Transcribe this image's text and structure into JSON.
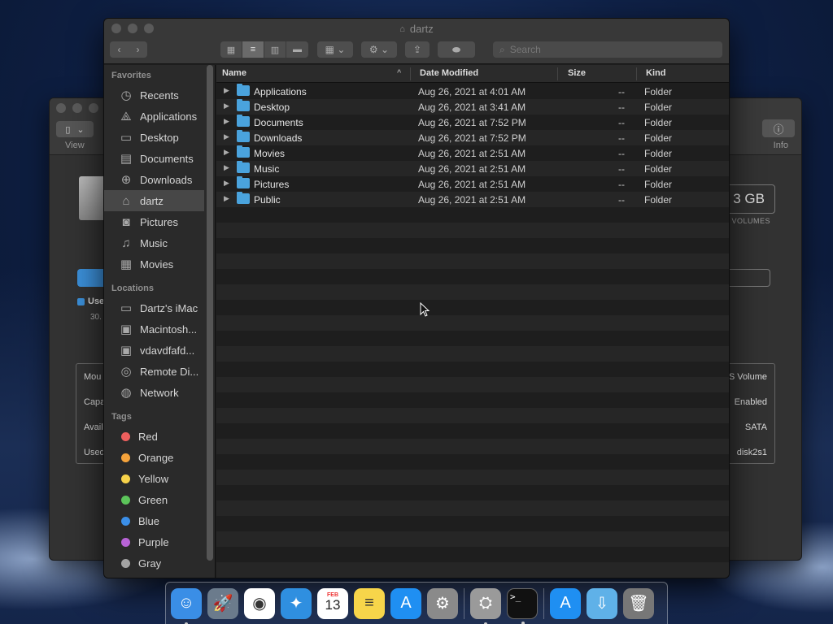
{
  "window": {
    "title": "dartz"
  },
  "toolbar": {
    "search_placeholder": "Search"
  },
  "sidebar": {
    "favorites_header": "Favorites",
    "favorites": [
      {
        "label": "Recents",
        "icon": "clock-icon"
      },
      {
        "label": "Applications",
        "icon": "applications-icon"
      },
      {
        "label": "Desktop",
        "icon": "desktop-icon"
      },
      {
        "label": "Documents",
        "icon": "documents-icon"
      },
      {
        "label": "Downloads",
        "icon": "downloads-icon"
      },
      {
        "label": "dartz",
        "icon": "home-icon",
        "selected": true
      },
      {
        "label": "Pictures",
        "icon": "camera-icon"
      },
      {
        "label": "Music",
        "icon": "music-icon"
      },
      {
        "label": "Movies",
        "icon": "film-icon"
      }
    ],
    "locations_header": "Locations",
    "locations": [
      {
        "label": "Dartz's iMac",
        "icon": "imac-icon"
      },
      {
        "label": "Macintosh...",
        "icon": "disk-icon"
      },
      {
        "label": "vdavdfafd...",
        "icon": "disk-icon"
      },
      {
        "label": "Remote Di...",
        "icon": "optical-disk-icon"
      },
      {
        "label": "Network",
        "icon": "globe-icon"
      }
    ],
    "tags_header": "Tags",
    "tags": [
      {
        "label": "Red",
        "color": "#ec5f5d"
      },
      {
        "label": "Orange",
        "color": "#f5a33b"
      },
      {
        "label": "Yellow",
        "color": "#f7d24a"
      },
      {
        "label": "Green",
        "color": "#5cc45a"
      },
      {
        "label": "Blue",
        "color": "#3b8fe8"
      },
      {
        "label": "Purple",
        "color": "#b863d6"
      },
      {
        "label": "Gray",
        "color": "#a3a3a3"
      }
    ]
  },
  "columns": {
    "name": "Name",
    "date": "Date Modified",
    "size": "Size",
    "kind": "Kind"
  },
  "files": [
    {
      "name": "Applications",
      "date": "Aug 26, 2021 at 4:01 AM",
      "size": "--",
      "kind": "Folder"
    },
    {
      "name": "Desktop",
      "date": "Aug 26, 2021 at 3:41 AM",
      "size": "--",
      "kind": "Folder"
    },
    {
      "name": "Documents",
      "date": "Aug 26, 2021 at 7:52 PM",
      "size": "--",
      "kind": "Folder"
    },
    {
      "name": "Downloads",
      "date": "Aug 26, 2021 at 7:52 PM",
      "size": "--",
      "kind": "Folder"
    },
    {
      "name": "Movies",
      "date": "Aug 26, 2021 at 2:51 AM",
      "size": "--",
      "kind": "Folder"
    },
    {
      "name": "Music",
      "date": "Aug 26, 2021 at 2:51 AM",
      "size": "--",
      "kind": "Folder"
    },
    {
      "name": "Pictures",
      "date": "Aug 26, 2021 at 2:51 AM",
      "size": "--",
      "kind": "Folder"
    },
    {
      "name": "Public",
      "date": "Aug 26, 2021 at 2:51 AM",
      "size": "--",
      "kind": "Folder"
    }
  ],
  "background_window": {
    "view_label": "View",
    "info_label": "Info",
    "capacity": "3 GB",
    "volumes_label": "VOLUMES",
    "used_label": "Use",
    "used_value": "30.",
    "rows_left": [
      "Mou",
      "Capa",
      "Avail",
      "Used"
    ],
    "rows_right": [
      "S Volume",
      "Enabled",
      "SATA",
      "disk2s1"
    ]
  },
  "dock": {
    "calendar_month": "FEB",
    "calendar_day": "13",
    "apps": [
      {
        "name": "finder-icon",
        "color": "#3a8ee6"
      },
      {
        "name": "launchpad-icon",
        "color": "#6b7b8c"
      },
      {
        "name": "chrome-icon",
        "color": "#ffffff"
      },
      {
        "name": "safari-icon",
        "color": "#2f8fe0"
      },
      {
        "name": "calendar-icon",
        "color": "#ffffff"
      },
      {
        "name": "notes-icon",
        "color": "#f7d54a"
      },
      {
        "name": "app-store-icon",
        "color": "#1f8ff2"
      },
      {
        "name": "system-preferences-icon",
        "color": "#8a8a8a"
      },
      {
        "name": "disk-utility-icon",
        "color": "#9a9a9a"
      },
      {
        "name": "terminal-icon",
        "color": "#111111"
      },
      {
        "name": "app-store-folder-icon",
        "color": "#1f8ff2"
      },
      {
        "name": "downloads-folder-icon",
        "color": "#5fb1e8"
      },
      {
        "name": "trash-icon",
        "color": "#777777"
      }
    ]
  }
}
